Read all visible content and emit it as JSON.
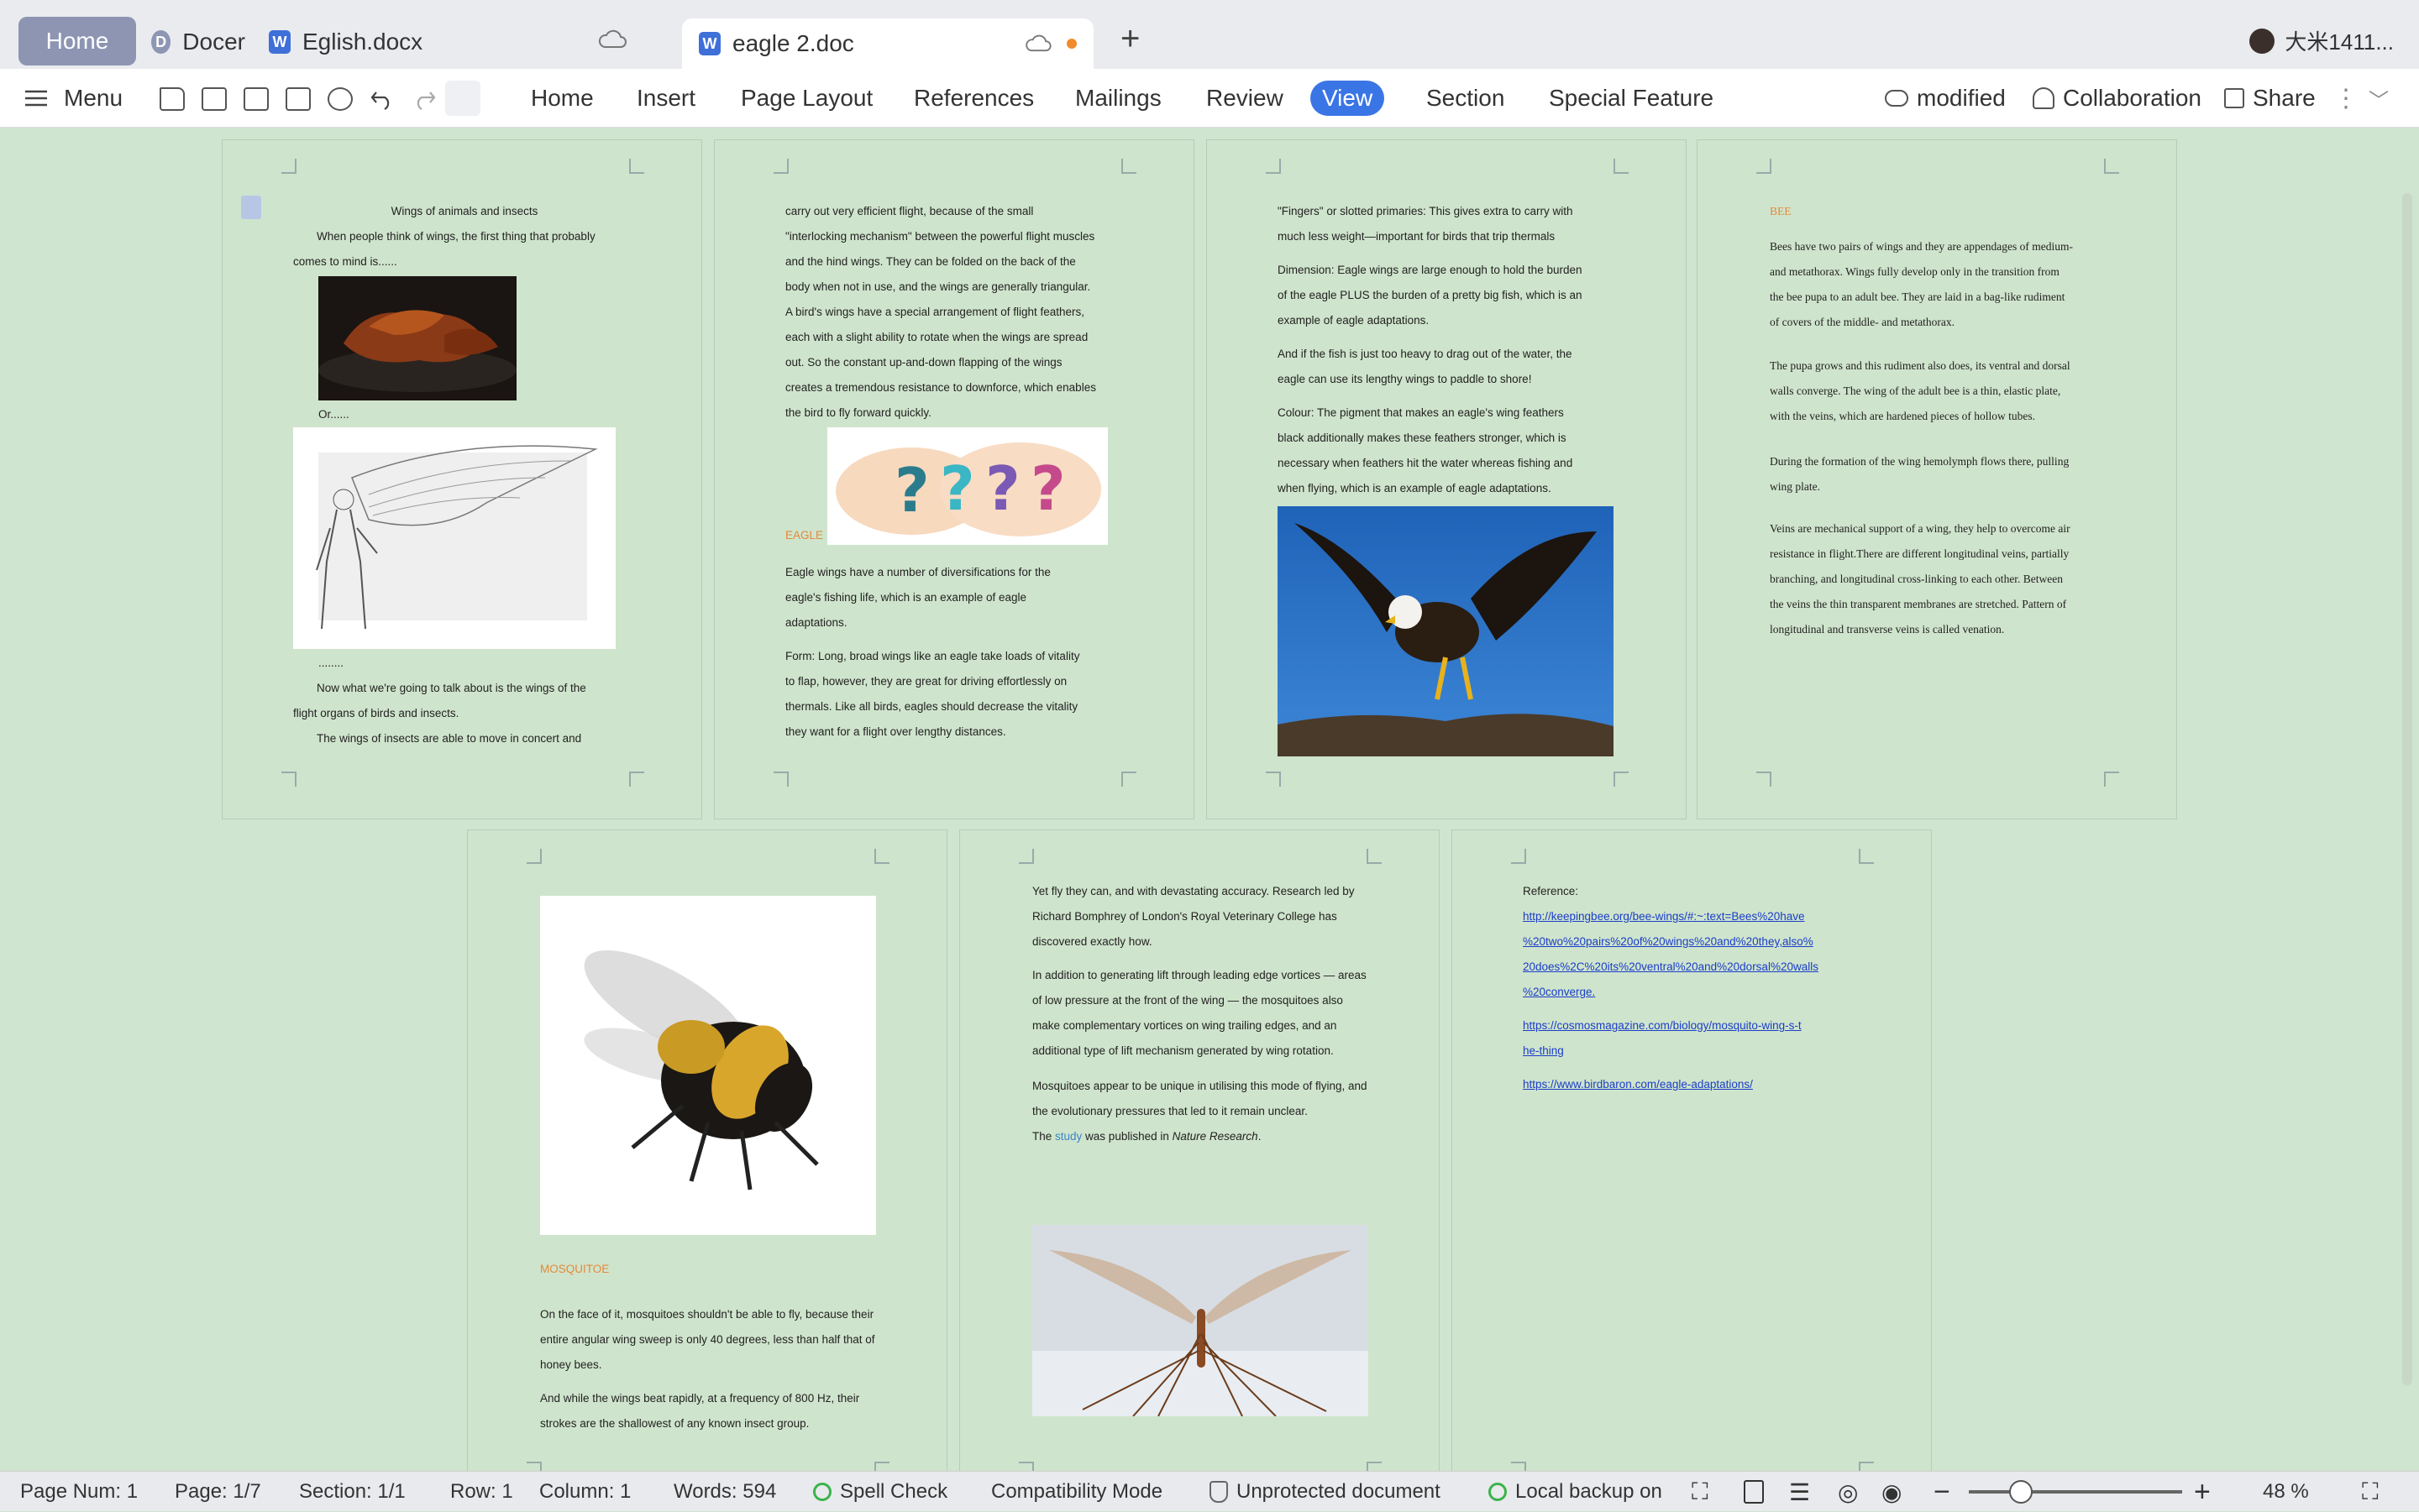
{
  "tabs": {
    "home": "Home",
    "docer": "Docer",
    "eglish": "Eglish.docx",
    "active": "eagle 2.doc",
    "user": "大米1411..."
  },
  "toolbar": {
    "menu": "Menu",
    "tabs": [
      "Home",
      "Insert",
      "Page Layout",
      "References",
      "Mailings",
      "Review",
      "View",
      "Section",
      "Special Feature"
    ],
    "modified": "modified",
    "collaboration": "Collaboration",
    "share": "Share"
  },
  "pages": {
    "p1": {
      "title": "Wings of animals and insects",
      "intro1": "When people think of wings, the first thing that probably",
      "intro2": "comes to mind is......",
      "or": "Or......",
      "dots": "........",
      "now1": "Now what we're going to talk about is the wings of the",
      "now2": "flight organs of birds and insects.",
      "ins": "The wings of insects are able to move in concert and"
    },
    "p2": {
      "l1": "carry out very efficient flight, because of the small",
      "l2": "\"interlocking mechanism\" between the powerful flight muscles",
      "l3": "and the hind  wings. They can be folded on the back of the",
      "l4": "body when not in use, and the wings are generally triangular.",
      "l5": "A bird's wings have a special arrangement of flight feathers,",
      "l6": "each with a slight ability to rotate when the wings are spread",
      "l7": "out. So the constant up-and-down flapping of the wings",
      "l8": "creates a tremendous resistance to downforce, which enables",
      "l9": "the bird to fly forward quickly.",
      "eagle": "EAGLE",
      "e1": "Eagle wings have a number of diversifications for the",
      "e2": "eagle's fishing life, which is an example of eagle",
      "e3": "adaptations.",
      "f1": "Form: Long, broad wings like an eagle take loads of vitality",
      "f2": "to flap, however, they are great for driving effortlessly on",
      "f3": "thermals. Like all birds, eagles should decrease the vitality",
      "f4": "they want for a flight over lengthy distances."
    },
    "p3": {
      "a1": "\"Fingers\" or slotted primaries: This gives extra to carry with",
      "a2": "much less weight—important for birds that trip thermals",
      "b1": "Dimension: Eagle wings are large enough to hold the burden",
      "b2": "of the eagle PLUS the burden of a pretty big fish, which is an",
      "b3": "example of eagle adaptations.",
      "c1": "And if the fish is just too heavy to drag out of the water, the",
      "c2": "eagle can use its lengthy wings to paddle to shore!",
      "d1": "Colour: The pigment that makes an eagle's wing feathers",
      "d2": "black additionally makes these feathers stronger, which is",
      "d3": "necessary when feathers hit the water whereas fishing and",
      "d4": "when flying, which is an example of eagle adaptations."
    },
    "p4": {
      "bee": "BEE",
      "a1": "Bees have two pairs of wings and they are appendages of medium-",
      "a2": "and metathorax. Wings fully develop only in the transition from",
      "a3": "the bee pupa to an adult bee. They are laid in a bag-like rudiment",
      "a4": "of covers of the middle- and metathorax.",
      "b1": "The pupa grows and this rudiment also does, its ventral and dorsal",
      "b2": "walls converge. The wing of the adult bee is a thin, elastic plate,",
      "b3": "with the veins, which are hardened pieces of hollow tubes.",
      "c1": "During the formation of the wing hemolymph flows there, pulling",
      "c2": "wing plate.",
      "d1": "Veins are mechanical support of a wing, they help to overcome air",
      "d2": "resistance in flight.There are different longitudinal veins, partially",
      "d3": "branching, and longitudinal cross-linking to each other. Between",
      "d4": "the veins the thin transparent membranes are stretched. Pattern of",
      "d5": "longitudinal and transverse veins is called venation."
    },
    "p5": {
      "mosq": "MOSQUITOE",
      "a1": "On the face of it, mosquitoes shouldn't be able to fly, because their",
      "a2": "entire angular wing sweep is only 40 degrees, less than half that of",
      "a3": "honey bees.",
      "b1": "And while the wings beat rapidly, at a frequency of 800 Hz, their",
      "b2": "strokes are the shallowest of any known insect group."
    },
    "p6": {
      "a1": "Yet fly they can, and with devastating accuracy. Research led by",
      "a2": "Richard Bomphrey of London's Royal Veterinary College has",
      "a3": "discovered exactly how.",
      "b1": "In addition to generating lift through leading edge vortices — areas",
      "b2": "of low pressure at the front of the wing — the mosquitoes also",
      "b3": "make complementary vortices on wing trailing edges, and an",
      "b4": "additional type of lift mechanism generated by wing rotation.",
      "c1": "Mosquitoes appear to be unique in utilising this mode of flying, and",
      "c2": "the evolutionary pressures that led to it remain unclear.",
      "d_pre": "The ",
      "d_link": "study",
      "d_mid": " was published in ",
      "d_it": "Nature Research",
      "d_end": "."
    },
    "p7": {
      "ref": "Reference:",
      "l1": "http://keepingbee.org/bee-wings/#:~:text=Bees%20have",
      "l2": "%20two%20pairs%20of%20wings%20and%20they,also%",
      "l3": "20does%2C%20its%20ventral%20and%20dorsal%20walls",
      "l4": "%20converge.",
      "m1": "https://cosmosmagazine.com/biology/mosquito-wing-s-t",
      "m2": "he-thing",
      "n1": "https://www.birdbaron.com/eagle-adaptations/"
    }
  },
  "status": {
    "page_num": "Page Num: 1",
    "page": "Page: 1/7",
    "section": "Section: 1/1",
    "row": "Row: 1",
    "column": "Column: 1",
    "words": "Words: 594",
    "spell": "Spell Check",
    "compat": "Compatibility Mode",
    "unprot": "Unprotected document",
    "backup": "Local backup on",
    "zoom": "48 %"
  }
}
